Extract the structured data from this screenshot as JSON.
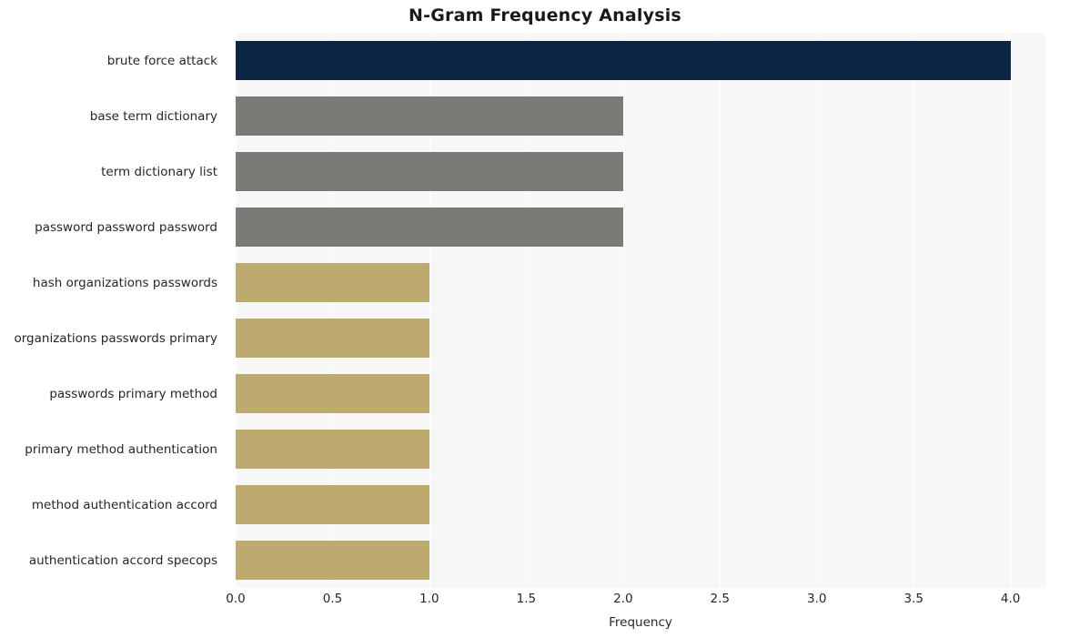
{
  "chart_data": {
    "type": "bar",
    "orientation": "horizontal",
    "title": "N-Gram Frequency Analysis",
    "xlabel": "Frequency",
    "ylabel": "",
    "xlim": [
      0,
      4.18
    ],
    "xticks": [
      "0.0",
      "0.5",
      "1.0",
      "1.5",
      "2.0",
      "2.5",
      "3.0",
      "3.5",
      "4.0"
    ],
    "xtick_values": [
      0.0,
      0.5,
      1.0,
      1.5,
      2.0,
      2.5,
      3.0,
      3.5,
      4.0
    ],
    "grid": true,
    "legend": "none",
    "categories": [
      "brute force attack",
      "base term dictionary",
      "term dictionary list",
      "password password password",
      "hash organizations passwords",
      "organizations passwords primary",
      "passwords primary method",
      "primary method authentication",
      "method authentication accord",
      "authentication accord specops"
    ],
    "values": [
      4,
      2,
      2,
      2,
      1,
      1,
      1,
      1,
      1,
      1
    ],
    "bar_colors": [
      "#0b2545",
      "#7c7a77",
      "#7c7a77",
      "#7c7a77",
      "#bcaa6e",
      "#bcaa6e",
      "#bcaa6e",
      "#bcaa6e",
      "#bcaa6e",
      "#bcaa6e"
    ],
    "plot_background": "#f7f7f7",
    "figure_background": "#ffffff"
  }
}
